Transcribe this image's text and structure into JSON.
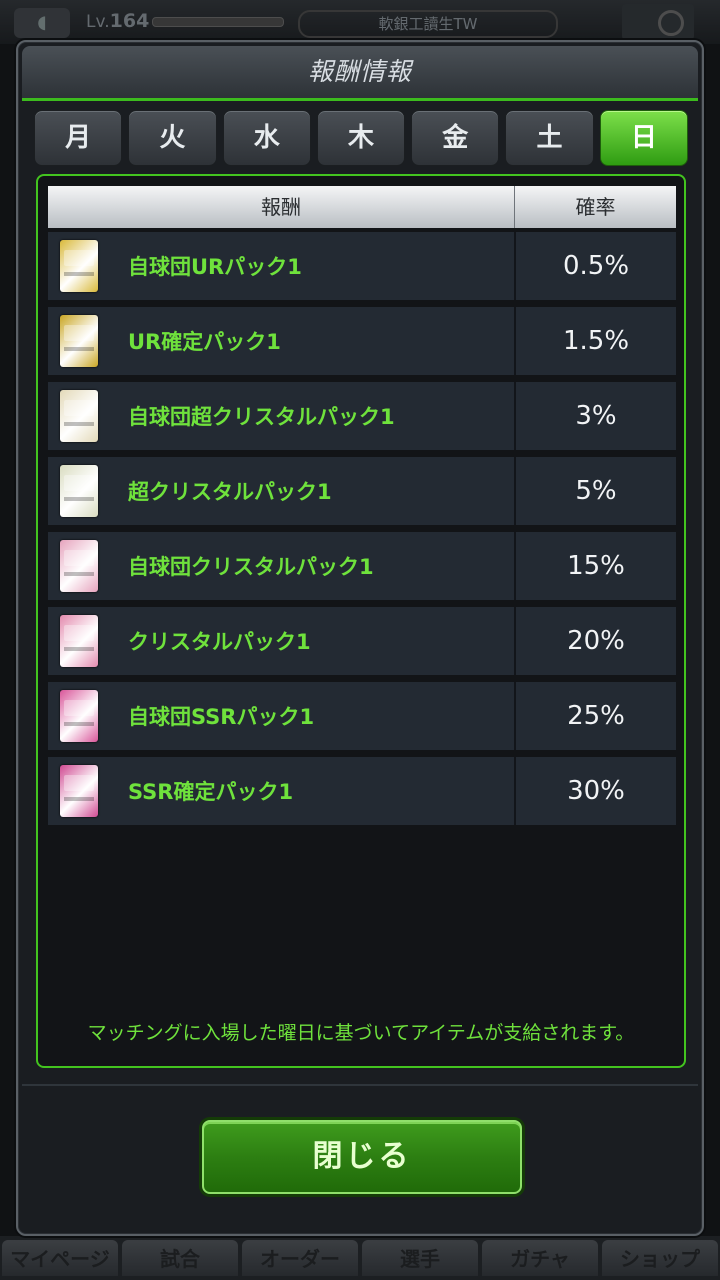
{
  "background": {
    "level_label": "Lv.",
    "level_value": "164",
    "team_name": "軟銀工讀生TW",
    "nav": [
      "マイページ",
      "試合",
      "オーダー",
      "選手",
      "ガチャ",
      "ショップ"
    ]
  },
  "modal": {
    "title": "報酬情報",
    "tabs": [
      "月",
      "火",
      "水",
      "木",
      "金",
      "土",
      "日"
    ],
    "active_tab": "日",
    "table": {
      "header_reward": "報酬",
      "header_rate": "確率",
      "rows": [
        {
          "name": "自球団URパック1",
          "rate": "0.5%",
          "pack_color": "#d9b93a"
        },
        {
          "name": "UR確定パック1",
          "rate": "1.5%",
          "pack_color": "#c9a623"
        },
        {
          "name": "自球団超クリスタルパック1",
          "rate": "3%",
          "pack_color": "#e3d9b8"
        },
        {
          "name": "超クリスタルパック1",
          "rate": "5%",
          "pack_color": "#d9dcc0"
        },
        {
          "name": "自球団クリスタルパック1",
          "rate": "15%",
          "pack_color": "#e6a3bd"
        },
        {
          "name": "クリスタルパック1",
          "rate": "20%",
          "pack_color": "#e38aae"
        },
        {
          "name": "自球団SSRパック1",
          "rate": "25%",
          "pack_color": "#d9569a"
        },
        {
          "name": "SSR確定パック1",
          "rate": "30%",
          "pack_color": "#d04a92"
        }
      ]
    },
    "note": "マッチングに入場した曜日に基づいてアイテムが支給されます。",
    "close_label": "閉じる"
  }
}
